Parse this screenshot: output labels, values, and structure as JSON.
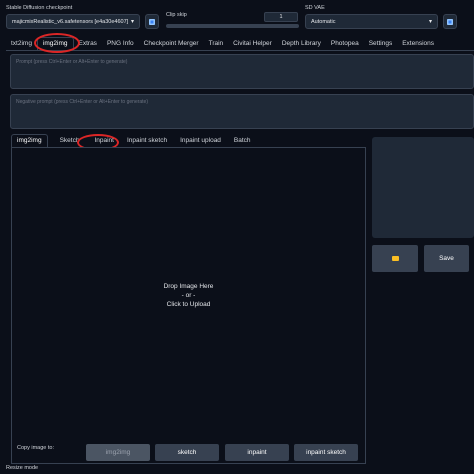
{
  "checkpoint": {
    "label": "Stable Diffusion checkpoint",
    "value": "majicmixRealistic_v6.safetensors [e4a30e4607]"
  },
  "clip_skip": {
    "label": "Clip skip",
    "value": "1",
    "fraction": 0.0
  },
  "vae": {
    "label": "SD VAE",
    "value": "Automatic"
  },
  "main_tabs": [
    "txt2img",
    "img2img",
    "Extras",
    "PNG Info",
    "Checkpoint Merger",
    "Train",
    "Civitai Helper",
    "Depth Library",
    "Photopea",
    "Settings",
    "Extensions"
  ],
  "prompt_placeholder": "Prompt (press Ctrl+Enter or Alt+Enter to generate)",
  "negative_placeholder": "Negative prompt (press Ctrl+Enter or Alt+Enter to generate)",
  "sub_tabs": [
    "img2img",
    "Sketch",
    "Inpaint",
    "Inpaint sketch",
    "Inpaint upload",
    "Batch"
  ],
  "upload": {
    "line1": "Drop Image Here",
    "line2": "- or -",
    "line3": "Click to Upload"
  },
  "copy_label": "Copy image to:",
  "copy_buttons": [
    "img2img",
    "sketch",
    "inpaint",
    "inpaint sketch"
  ],
  "actions": {
    "folder_icon": "folder-icon",
    "save_label": "Save"
  },
  "resize_label": "Resize mode",
  "colors": {
    "accent": "#3b82f6",
    "annotation": "#dc2626",
    "background": "#0b0f19"
  }
}
